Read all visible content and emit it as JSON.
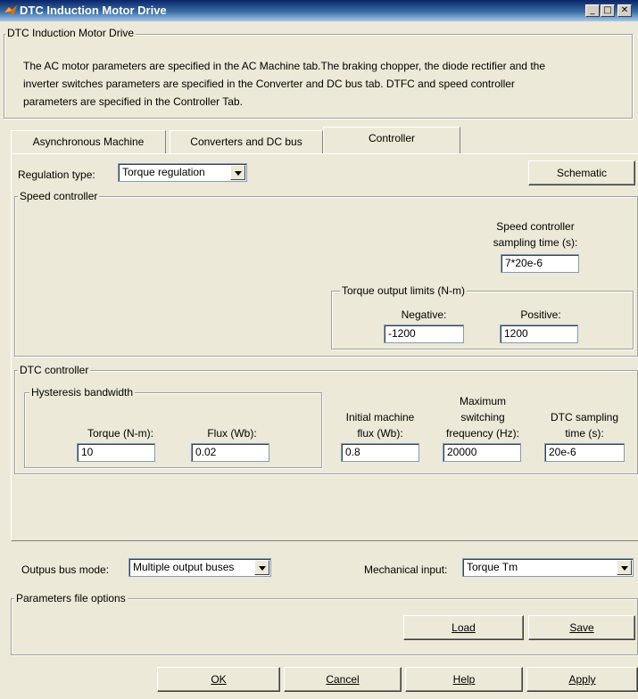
{
  "window": {
    "title": "DTC Induction Motor Drive",
    "minimize": "_",
    "maximize": "□",
    "close": "✕"
  },
  "mask": {
    "group_label": "DTC Induction Motor Drive",
    "description_line1": "The AC motor parameters are specified in the AC Machine tab.The braking chopper, the diode rectifier and the",
    "description_line2": "inverter switches parameters are specified in the Converter and DC bus tab. DTFC and speed controller",
    "description_line3": "parameters are specified in the Controller Tab."
  },
  "tabs": [
    {
      "label": "Asynchronous Machine"
    },
    {
      "label": "Converters and DC bus"
    },
    {
      "label": "Controller"
    }
  ],
  "controller": {
    "regulation_label": "Regulation type:",
    "regulation_value": "Torque regulation",
    "schematic_label": "Schematic",
    "speed_group": "Speed controller",
    "speed_sampling_label1": "Speed controller",
    "speed_sampling_label2": "sampling time (s):",
    "speed_sampling_value": "7*20e-6",
    "torque_limits_group": "Torque output limits (N-m)",
    "negative_label": "Negative:",
    "negative_value": "-1200",
    "positive_label": "Positive:",
    "positive_value": "1200",
    "dtc_group": "DTC controller",
    "hysteresis_group": "Hysteresis bandwidth",
    "torque_label": "Torque (N-m):",
    "torque_value": "10",
    "flux_label": "Flux (Wb):",
    "flux_value": "0.02",
    "init_flux_label1": "Initial machine",
    "init_flux_label2": "flux (Wb):",
    "init_flux_value": "0.8",
    "max_freq_label1": "Maximum",
    "max_freq_label2": "switching",
    "max_freq_label3": "frequency (Hz):",
    "max_freq_value": "20000",
    "dtc_sampling_label1": "DTC sampling",
    "dtc_sampling_label2": "time (s):",
    "dtc_sampling_value": "20e-6"
  },
  "bottom": {
    "output_bus_label": "Outpus bus mode:",
    "output_bus_value": "Multiple output buses",
    "mech_input_label": "Mechanical input:",
    "mech_input_value": "Torque Tm",
    "params_file_group": "Parameters file options",
    "load_label": "Load",
    "save_label": "Save"
  },
  "dialog_buttons": {
    "ok": "OK",
    "cancel": "Cancel",
    "help": "Help",
    "apply": "Apply"
  }
}
